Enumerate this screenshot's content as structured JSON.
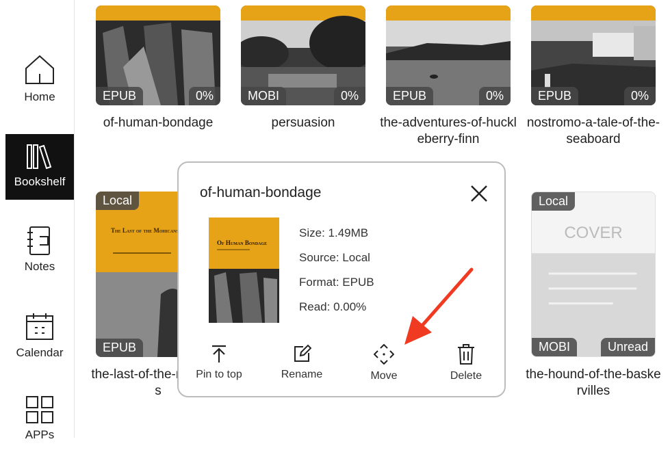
{
  "sidebar": {
    "items": [
      {
        "label": "Home",
        "icon": "home-icon"
      },
      {
        "label": "Bookshelf",
        "icon": "bookshelf-icon",
        "active": true
      },
      {
        "label": "Notes",
        "icon": "notes-icon"
      },
      {
        "label": "Calendar",
        "icon": "calendar-icon"
      },
      {
        "label": "APPs",
        "icon": "apps-icon"
      }
    ]
  },
  "books_top": [
    {
      "title": "of-human-bondage",
      "format": "EPUB",
      "progress": "0%"
    },
    {
      "title": "persuasion",
      "format": "MOBI",
      "progress": "0%"
    },
    {
      "title": "the-adventures-of-huckleberry-finn",
      "format": "EPUB",
      "progress": "0%"
    },
    {
      "title": "nostromo-a-tale-of-the-seaboard",
      "format": "EPUB",
      "progress": "0%"
    }
  ],
  "books_bottom": [
    {
      "title": "the-last-of-the-mohicans",
      "format": "EPUB",
      "source_badge": "Local",
      "cover_text": "The Last of the Mohicans"
    },
    {
      "title": "the-hound-of-the-baskervilles",
      "format": "MOBI",
      "source_badge": "Local",
      "status": "Unread",
      "cover_text": "COVER"
    }
  ],
  "dialog": {
    "title": "of-human-bondage",
    "cover_text": "Of Human Bondage",
    "size": "Size: 1.49MB",
    "source": "Source: Local",
    "format": "Format: EPUB",
    "read": "Read: 0.00%",
    "actions": [
      {
        "label": "Pin to top",
        "icon": "pin-to-top-icon"
      },
      {
        "label": "Rename",
        "icon": "rename-icon"
      },
      {
        "label": "Move",
        "icon": "move-icon"
      },
      {
        "label": "Delete",
        "icon": "delete-icon"
      }
    ]
  },
  "colors": {
    "accent": "#e6a317",
    "badge": "#4a4a4a",
    "active_nav": "#111111",
    "arrow": "#f03a22"
  }
}
